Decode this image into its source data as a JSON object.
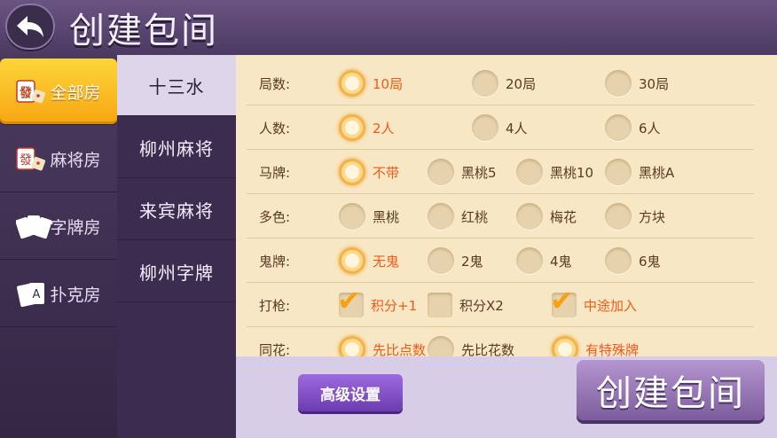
{
  "header": {
    "title": "创建包间"
  },
  "categories": [
    {
      "label": "全部房",
      "icon": "mahjong-dice-icon",
      "active": true
    },
    {
      "label": "麻将房",
      "icon": "mahjong-dice-icon",
      "active": false
    },
    {
      "label": "字牌房",
      "icon": "cards-icon",
      "active": false
    },
    {
      "label": "扑克房",
      "icon": "poker-icon",
      "active": false
    }
  ],
  "games": [
    {
      "label": "十三水",
      "active": true
    },
    {
      "label": "柳州麻将",
      "active": false
    },
    {
      "label": "来宾麻将",
      "active": false
    },
    {
      "label": "柳州字牌",
      "active": false
    }
  ],
  "options": [
    {
      "label": "局数:",
      "type": "radio",
      "choices": [
        {
          "text": "10局",
          "on": true
        },
        {
          "text": "20局",
          "on": false
        },
        {
          "text": "30局",
          "on": false
        }
      ]
    },
    {
      "label": "人数:",
      "type": "radio",
      "choices": [
        {
          "text": "2人",
          "on": true
        },
        {
          "text": "4人",
          "on": false
        },
        {
          "text": "6人",
          "on": false
        }
      ]
    },
    {
      "label": "马牌:",
      "type": "radio",
      "choices": [
        {
          "text": "不带",
          "on": true
        },
        {
          "text": "黑桃5",
          "on": false
        },
        {
          "text": "黑桃10",
          "on": false
        },
        {
          "text": "黑桃A",
          "on": false
        }
      ]
    },
    {
      "label": "多色:",
      "type": "radio",
      "choices": [
        {
          "text": "黑桃",
          "on": false
        },
        {
          "text": "红桃",
          "on": false
        },
        {
          "text": "梅花",
          "on": false
        },
        {
          "text": "方块",
          "on": false
        }
      ]
    },
    {
      "label": "鬼牌:",
      "type": "radio",
      "choices": [
        {
          "text": "无鬼",
          "on": true
        },
        {
          "text": "2鬼",
          "on": false
        },
        {
          "text": "4鬼",
          "on": false
        },
        {
          "text": "6鬼",
          "on": false
        }
      ]
    },
    {
      "label": "打枪:",
      "type": "check",
      "choices": [
        {
          "text": "积分+1",
          "on": true
        },
        {
          "text": "积分X2",
          "on": false
        },
        {
          "text": "中途加入",
          "on": true
        }
      ]
    },
    {
      "label": "同花:",
      "type": "radio",
      "choices": [
        {
          "text": "先比点数",
          "on": true
        },
        {
          "text": "先比花数",
          "on": false
        },
        {
          "text": "有特殊牌",
          "on": true
        }
      ]
    }
  ],
  "buttons": {
    "advanced": "高级设置",
    "create": "创建包间"
  }
}
